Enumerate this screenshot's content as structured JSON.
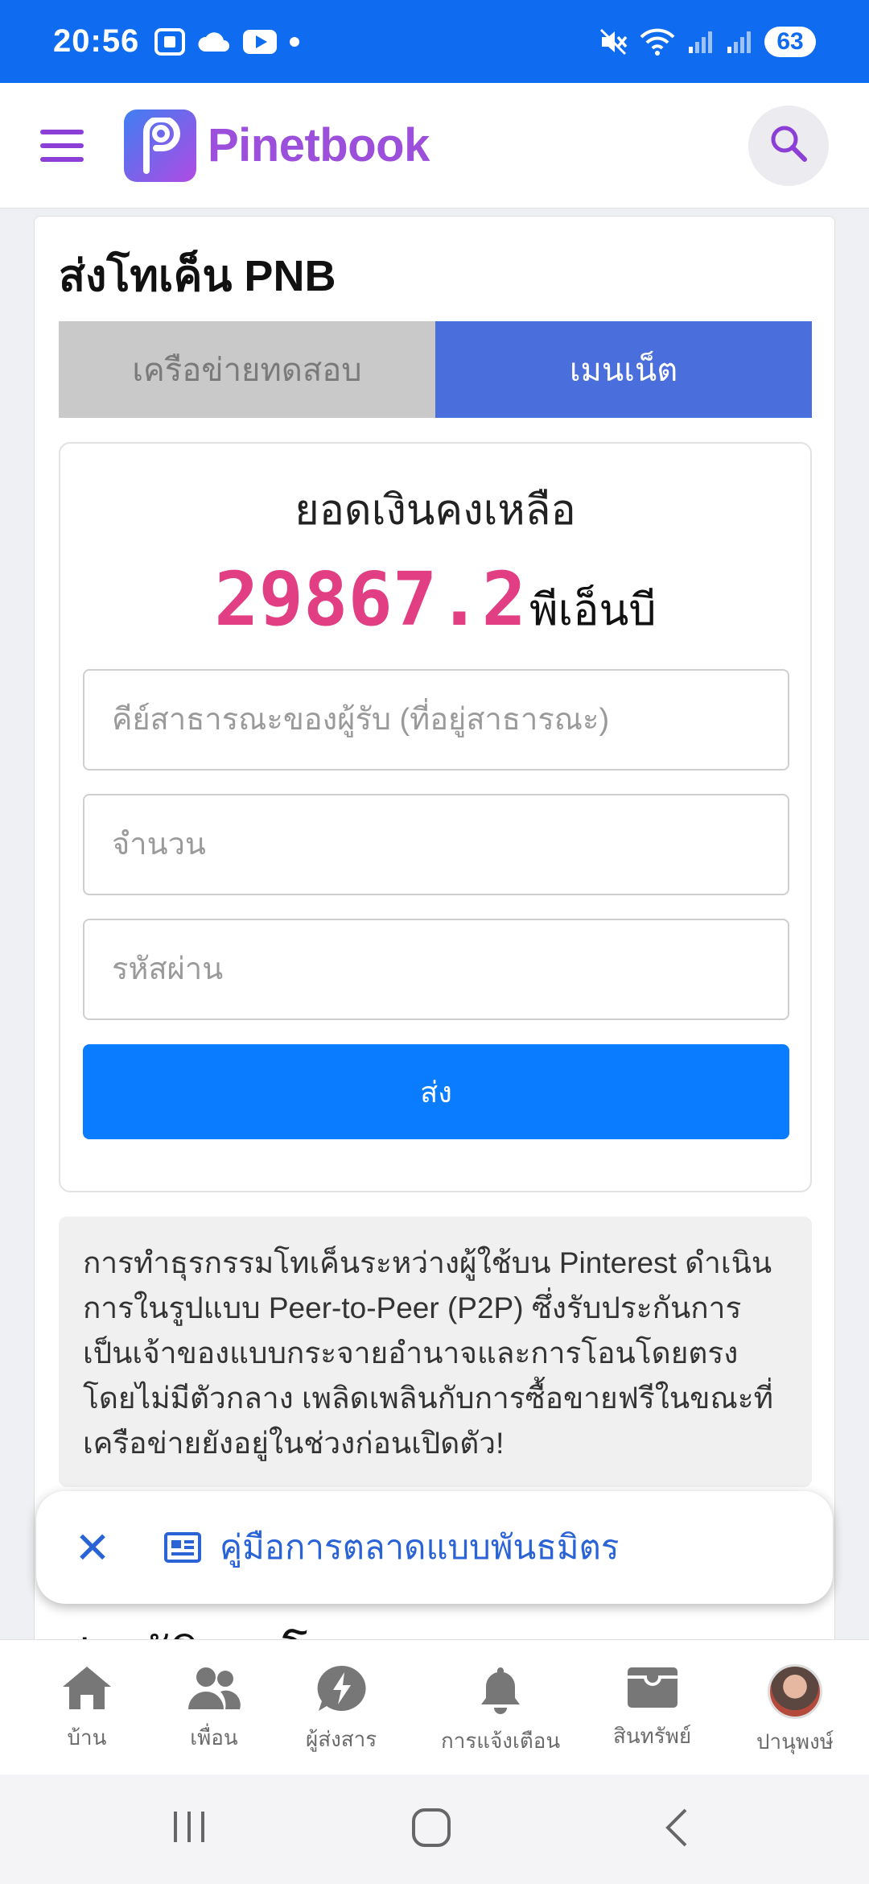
{
  "status_bar": {
    "time": "20:56",
    "battery": "63"
  },
  "header": {
    "app_name": "Pinetbook"
  },
  "page": {
    "title": "ส่งโทเค็น PNB",
    "tabs": [
      {
        "label": "เครือข่ายทดสอบ",
        "active": false
      },
      {
        "label": "เมนเน็ต",
        "active": true
      }
    ]
  },
  "wallet": {
    "balance_label": "ยอดเงินคงเหลือ",
    "balance_amount": "29867.2",
    "balance_unit": "พีเอ็นบี",
    "pubkey_placeholder": "คีย์สาธารณะของผู้รับ (ที่อยู่สาธารณะ)",
    "amount_placeholder": "จำนวน",
    "password_placeholder": "รหัสผ่าน",
    "send_label": "ส่ง"
  },
  "info_text": "การทำธุรกรรมโทเค็นระหว่างผู้ใช้บน Pinterest ดำเนินการในรูปแบบ Peer-to-Peer (P2P) ซึ่งรับประกันการเป็นเจ้าของแบบกระจายอำนาจและการโอนโดยตรงโดยไม่มีตัวกลาง เพลิดเพลินกับการซื้อขายฟรีในขณะที่เครือข่ายยังอยู่ในช่วงก่อนเปิดตัว!",
  "history_title": "ประวัติการโอน",
  "banner": {
    "label": "คู่มือการตลาดแบบพันธมิตร"
  },
  "bottom_nav": [
    {
      "label": "บ้าน",
      "icon": "home-icon"
    },
    {
      "label": "เพื่อน",
      "icon": "friends-icon"
    },
    {
      "label": "ผู้ส่งสาร",
      "icon": "messenger-icon"
    },
    {
      "label": "การแจ้งเตือน",
      "icon": "bell-icon"
    },
    {
      "label": "สินทรัพย์",
      "icon": "wallet-icon"
    },
    {
      "label": "ปานุพงษ์",
      "icon": "avatar"
    }
  ],
  "colors": {
    "status_bar": "#0f6bef",
    "brand_purple": "#9b4fdb",
    "tab_active": "#4a6fdc",
    "balance_pink": "#e23e83",
    "send_button": "#0a7cff",
    "link_blue": "#2a63d6"
  }
}
